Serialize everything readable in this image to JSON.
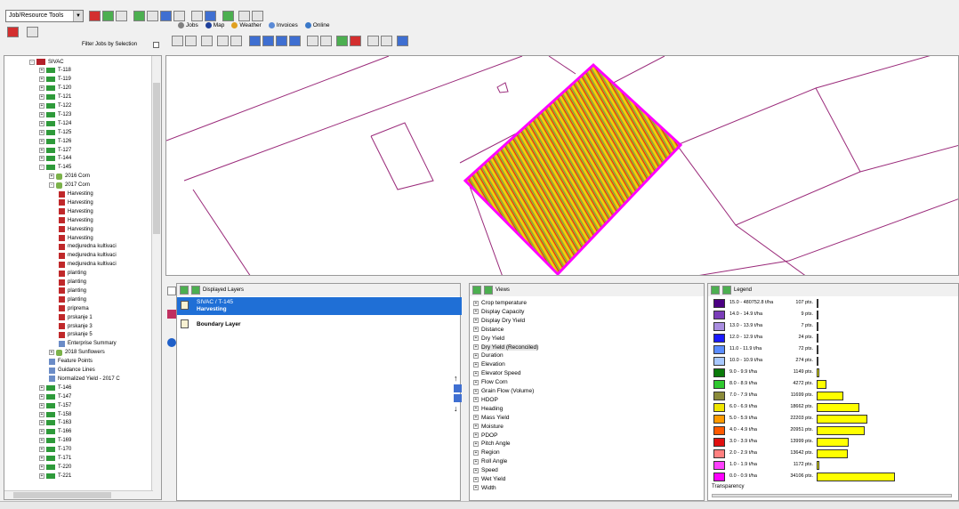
{
  "toolbar": {
    "combo_value": "Job/Resource Tools"
  },
  "tabs": [
    {
      "label": "Jobs",
      "color": "#808080"
    },
    {
      "label": "Map",
      "color": "#1e3f9a"
    },
    {
      "label": "Weather",
      "color": "#e0a020"
    },
    {
      "label": "Invoices",
      "color": "#5a8ad6"
    },
    {
      "label": "Online",
      "color": "#3a78c8"
    }
  ],
  "filter": {
    "label": "Filter Jobs by Selection"
  },
  "tree": {
    "items": [
      {
        "level": 0,
        "exp": "-",
        "icon": "farm",
        "label": "SIVAC"
      },
      {
        "level": 1,
        "exp": "+",
        "icon": "field",
        "label": "T-118"
      },
      {
        "level": 1,
        "exp": "+",
        "icon": "field",
        "label": "T-119"
      },
      {
        "level": 1,
        "exp": "+",
        "icon": "field",
        "label": "T-120"
      },
      {
        "level": 1,
        "exp": "+",
        "icon": "field",
        "label": "T-121"
      },
      {
        "level": 1,
        "exp": "+",
        "icon": "field",
        "label": "T-122"
      },
      {
        "level": 1,
        "exp": "+",
        "icon": "field",
        "label": "T-123"
      },
      {
        "level": 1,
        "exp": "+",
        "icon": "field",
        "label": "T-124"
      },
      {
        "level": 1,
        "exp": "+",
        "icon": "field",
        "label": "T-125"
      },
      {
        "level": 1,
        "exp": "+",
        "icon": "field",
        "label": "T-126"
      },
      {
        "level": 1,
        "exp": "+",
        "icon": "field",
        "label": "T-127"
      },
      {
        "level": 1,
        "exp": "+",
        "icon": "field",
        "label": "T-144"
      },
      {
        "level": 1,
        "exp": "-",
        "icon": "field",
        "label": "T-145"
      },
      {
        "level": 2,
        "exp": "+",
        "icon": "crop",
        "label": "2016 Corn"
      },
      {
        "level": 2,
        "exp": "-",
        "icon": "crop",
        "label": "2017 Corn"
      },
      {
        "level": 3,
        "exp": "",
        "icon": "op",
        "label": "Harvesting"
      },
      {
        "level": 3,
        "exp": "",
        "icon": "op",
        "label": "Harvesting"
      },
      {
        "level": 3,
        "exp": "",
        "icon": "op",
        "label": "Harvesting"
      },
      {
        "level": 3,
        "exp": "",
        "icon": "op",
        "label": "Harvesting"
      },
      {
        "level": 3,
        "exp": "",
        "icon": "op",
        "label": "Harvesting"
      },
      {
        "level": 3,
        "exp": "",
        "icon": "op",
        "label": "Harvesting"
      },
      {
        "level": 3,
        "exp": "",
        "icon": "op",
        "label": "medjuredna kultivaci"
      },
      {
        "level": 3,
        "exp": "",
        "icon": "op",
        "label": "medjuredna kultivaci"
      },
      {
        "level": 3,
        "exp": "",
        "icon": "op",
        "label": "medjuredna kultivaci"
      },
      {
        "level": 3,
        "exp": "",
        "icon": "op",
        "label": "planting"
      },
      {
        "level": 3,
        "exp": "",
        "icon": "op",
        "label": "planting"
      },
      {
        "level": 3,
        "exp": "",
        "icon": "op",
        "label": "planting"
      },
      {
        "level": 3,
        "exp": "",
        "icon": "op",
        "label": "planting"
      },
      {
        "level": 3,
        "exp": "",
        "icon": "op",
        "label": "priprema"
      },
      {
        "level": 3,
        "exp": "",
        "icon": "op",
        "label": "prskanje 1"
      },
      {
        "level": 3,
        "exp": "",
        "icon": "op",
        "label": "prskanje 3"
      },
      {
        "level": 3,
        "exp": "",
        "icon": "op",
        "label": "prskanje 5"
      },
      {
        "level": 3,
        "exp": "",
        "icon": "doc",
        "label": "Enterprise Summary"
      },
      {
        "level": 2,
        "exp": "+",
        "icon": "crop",
        "label": "2018 Sunflowers"
      },
      {
        "level": 2,
        "exp": "",
        "icon": "doc",
        "label": "Feature Points"
      },
      {
        "level": 2,
        "exp": "",
        "icon": "doc",
        "label": "Guidance Lines"
      },
      {
        "level": 2,
        "exp": "",
        "icon": "doc",
        "label": "Normalized Yield - 2017 C"
      },
      {
        "level": 1,
        "exp": "+",
        "icon": "field",
        "label": "T-146"
      },
      {
        "level": 1,
        "exp": "+",
        "icon": "field",
        "label": "T-147"
      },
      {
        "level": 1,
        "exp": "+",
        "icon": "field",
        "label": "T-157"
      },
      {
        "level": 1,
        "exp": "+",
        "icon": "field",
        "label": "T-158"
      },
      {
        "level": 1,
        "exp": "+",
        "icon": "field",
        "label": "T-163"
      },
      {
        "level": 1,
        "exp": "+",
        "icon": "field",
        "label": "T-166"
      },
      {
        "level": 1,
        "exp": "+",
        "icon": "field",
        "label": "T-169"
      },
      {
        "level": 1,
        "exp": "+",
        "icon": "field",
        "label": "T-170"
      },
      {
        "level": 1,
        "exp": "+",
        "icon": "field",
        "label": "T-171"
      },
      {
        "level": 1,
        "exp": "+",
        "icon": "field",
        "label": "T-220"
      },
      {
        "level": 1,
        "exp": "+",
        "icon": "field",
        "label": "T-221"
      }
    ]
  },
  "layers": {
    "header": "Displayed Layers",
    "items": [
      {
        "title": "SIVAC / T-145",
        "subtitle": "Harvesting",
        "selected": true
      },
      {
        "title": "Boundary Layer",
        "subtitle": "",
        "selected": false
      }
    ]
  },
  "views": {
    "header": "Views",
    "items": [
      "Crop temperature",
      "Display Capacity",
      "Display Dry Yield",
      "Distance",
      "Dry Yield",
      "Dry Yield (Reconciled)",
      "Duration",
      "Elevation",
      "Elevator Speed",
      "Flow Corn",
      "Grain Flow (Volume)",
      "HDOP",
      "Heading",
      "Mass Yield",
      "Moisture",
      "PDOP",
      "Pitch Angle",
      "Region",
      "Roll Angle",
      "Speed",
      "Wet Yield",
      "Width"
    ],
    "selected_index": 5
  },
  "legend": {
    "header": "Legend",
    "rows": [
      {
        "range": "15.0 - 480752.8 t/ha",
        "count": "107 pts.",
        "color": "#4b0082",
        "pts": 107
      },
      {
        "range": "14.0 - 14.9 t/ha",
        "count": "9 pts.",
        "color": "#7a3db8",
        "pts": 9
      },
      {
        "range": "13.0 - 13.9 t/ha",
        "count": "7 pts.",
        "color": "#a98ee0",
        "pts": 7
      },
      {
        "range": "12.0 - 12.9 t/ha",
        "count": "24 pts.",
        "color": "#1a1aff",
        "pts": 24
      },
      {
        "range": "11.0 - 11.9 t/ha",
        "count": "72 pts.",
        "color": "#5a8cff",
        "pts": 72
      },
      {
        "range": "10.0 - 10.9 t/ha",
        "count": "274 pts.",
        "color": "#a8c8ff",
        "pts": 274
      },
      {
        "range": "9.0 - 9.9 t/ha",
        "count": "1149 pts.",
        "color": "#0a7a0a",
        "pts": 1149
      },
      {
        "range": "8.0 - 8.9 t/ha",
        "count": "4272 pts.",
        "color": "#2ec82e",
        "pts": 4272
      },
      {
        "range": "7.0 - 7.9 t/ha",
        "count": "11699 pts.",
        "color": "#8a8a3a",
        "pts": 11699
      },
      {
        "range": "6.0 - 6.9 t/ha",
        "count": "18662 pts.",
        "color": "#f0e600",
        "pts": 18662
      },
      {
        "range": "5.0 - 5.9 t/ha",
        "count": "22203 pts.",
        "color": "#ff9a00",
        "pts": 22203
      },
      {
        "range": "4.0 - 4.9 t/ha",
        "count": "20951 pts.",
        "color": "#ff5a00",
        "pts": 20951
      },
      {
        "range": "3.0 - 3.9 t/ha",
        "count": "13999 pts.",
        "color": "#e01010",
        "pts": 13999
      },
      {
        "range": "2.0 - 2.9 t/ha",
        "count": "13642 pts.",
        "color": "#ff8080",
        "pts": 13642
      },
      {
        "range": "1.0 - 1.9 t/ha",
        "count": "1172 pts.",
        "color": "#ff40ff",
        "pts": 1172
      },
      {
        "range": "0.0 - 0.9 t/ha",
        "count": "34106 pts.",
        "color": "#ff00ff",
        "pts": 34106
      }
    ],
    "transparency_label": "Transparency"
  }
}
